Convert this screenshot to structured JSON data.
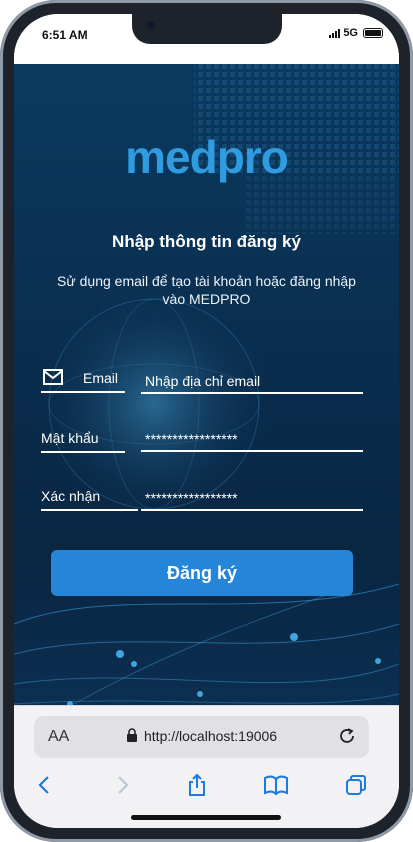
{
  "status_bar": {
    "time": "6:51 AM",
    "network": "5G"
  },
  "app": {
    "logo": "medpro",
    "title": "Nhập thông tin đăng ký",
    "subtitle": "Sử dụng email để tạo tài khoản hoặc đăng nhập vào MEDPRO",
    "email": {
      "label": "Email",
      "placeholder": "Nhập địa chỉ email",
      "icon": "mail-icon"
    },
    "password": {
      "label": "Mật khẩu",
      "value": "*****************"
    },
    "confirm": {
      "label": "Xác nhận",
      "value": "*****************"
    },
    "register_button": "Đăng ký"
  },
  "browser": {
    "text_size_label": "AA",
    "url": "http://localhost:19006",
    "icons": [
      "lock-icon",
      "reload-icon",
      "back-icon",
      "forward-icon",
      "share-icon",
      "bookmarks-icon",
      "tabs-icon"
    ]
  },
  "colors": {
    "accent": "#2585d8",
    "logo": "#2f9be0",
    "background": "#0a2d4e"
  }
}
